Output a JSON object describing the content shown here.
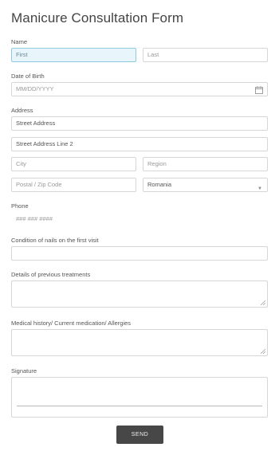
{
  "form": {
    "title": "Manicure Consultation Form",
    "name": {
      "label": "Name",
      "first_placeholder": "First",
      "last_placeholder": "Last"
    },
    "dob": {
      "label": "Date of Birth",
      "placeholder": "MM/DD/YYYY"
    },
    "address": {
      "label": "Address",
      "street_placeholder": "Street Address",
      "street2_placeholder": "Street Address Line 2",
      "city_placeholder": "City",
      "region_placeholder": "Region",
      "postal_placeholder": "Postal / Zip Code",
      "country_value": "Romania"
    },
    "phone": {
      "label": "Phone",
      "placeholder": "### ### ####"
    },
    "nails_condition": {
      "label": "Condition of nails on the first visit"
    },
    "previous_treatments": {
      "label": "Details of previous treatments"
    },
    "medical_history": {
      "label": "Medical history/ Current medication/ Allergies"
    },
    "signature": {
      "label": "Signature"
    },
    "submit_label": "SEND"
  }
}
